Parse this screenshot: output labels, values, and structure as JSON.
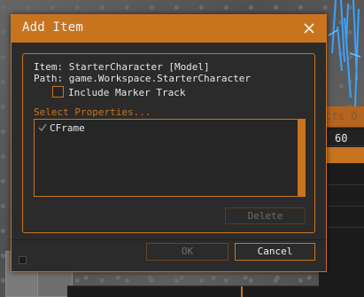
{
  "dialog": {
    "title": "Add Item",
    "close_icon": "close-icon",
    "item_line": "Item: StarterCharacter [Model]",
    "path_line": "Path: game.Workspace.StarterCharacter",
    "include_marker": {
      "label": "Include Marker Track",
      "checked": false
    },
    "select_label": "Select Properties...",
    "properties": [
      {
        "label": "CFrame",
        "checked": true
      }
    ],
    "delete_label": "Delete",
    "ok_label": "OK",
    "cancel_label": "Cancel"
  },
  "background_editor": {
    "tab_partial": "ects O",
    "value": "60"
  },
  "colors": {
    "accent": "#c8741f",
    "dialog_bg": "#2b2b2b",
    "list_bg": "#262626",
    "text": "#e6e6e6",
    "disabled_text": "#6e6e6e"
  }
}
